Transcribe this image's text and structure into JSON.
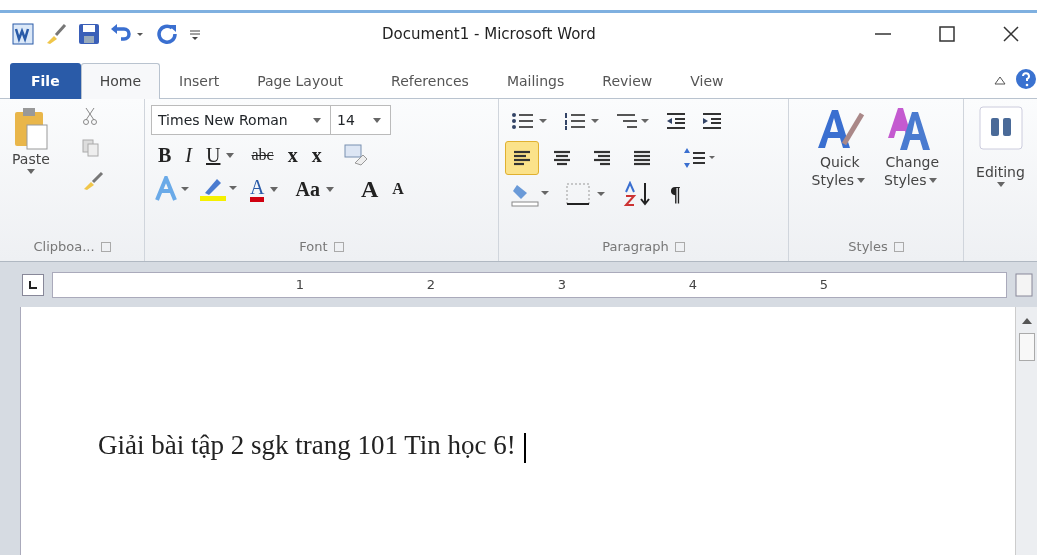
{
  "window": {
    "title": "Document1 - Microsoft Word"
  },
  "tabs": [
    {
      "label": "File",
      "kind": "file",
      "selected": false
    },
    {
      "label": "Home",
      "kind": "tab",
      "selected": true
    },
    {
      "label": "Insert",
      "kind": "tab",
      "selected": false
    },
    {
      "label": "Page Layout",
      "kind": "tab",
      "selected": false
    },
    {
      "label": "References",
      "kind": "tab",
      "selected": false
    },
    {
      "label": "Mailings",
      "kind": "tab",
      "selected": false
    },
    {
      "label": "Review",
      "kind": "tab",
      "selected": false
    },
    {
      "label": "View",
      "kind": "tab",
      "selected": false
    }
  ],
  "clipboard": {
    "paste": "Paste",
    "label": "Clipboa..."
  },
  "font": {
    "name": "Times New Roman",
    "size": "14",
    "label": "Font",
    "row1": [
      {
        "label": "B",
        "kind": "bold"
      },
      {
        "label": "I",
        "kind": "italic"
      },
      {
        "label": "U",
        "kind": "underline"
      },
      {
        "label": "abc",
        "kind": "strike"
      },
      {
        "label": "x",
        "kind": "sub"
      },
      {
        "label": "x",
        "kind": "sup"
      }
    ],
    "row2": [
      {
        "label": "A",
        "kind": "color"
      },
      {
        "label": "Aa",
        "kind": "case"
      },
      {
        "label": "A",
        "kind": "grow"
      },
      {
        "label": "A",
        "kind": "shrink"
      }
    ]
  },
  "paragraph": {
    "label": "Paragraph",
    "pilcrow": "¶",
    "align": [
      {
        "kind": "left",
        "selected": true
      },
      {
        "kind": "center",
        "selected": false
      },
      {
        "kind": "right",
        "selected": false
      },
      {
        "kind": "justify",
        "selected": false
      }
    ]
  },
  "styles": {
    "quick": [
      "Quick",
      "Styles"
    ],
    "change": [
      "Change",
      "Styles"
    ],
    "label": "Styles"
  },
  "editing": {
    "label": "Editing"
  },
  "ruler": {
    "marks": [
      "1",
      "2",
      "3",
      "4",
      "5"
    ]
  },
  "document": {
    "text": "Giải bài tập 2 sgk trang 101 Tin học 6!"
  }
}
